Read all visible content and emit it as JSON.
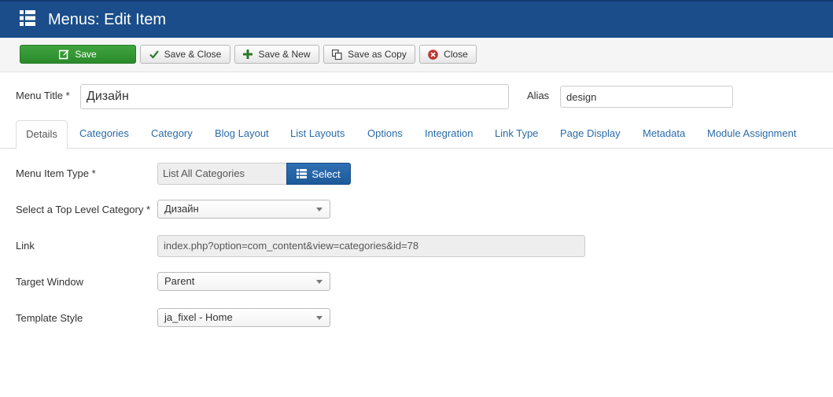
{
  "header": {
    "title": "Menus: Edit Item"
  },
  "toolbar": {
    "save": "Save",
    "save_close": "Save & Close",
    "save_new": "Save & New",
    "save_copy": "Save as Copy",
    "close": "Close"
  },
  "form": {
    "menu_title_label": "Menu Title *",
    "menu_title_value": "Дизайн",
    "alias_label": "Alias",
    "alias_value": "design"
  },
  "tabs": [
    {
      "label": "Details"
    },
    {
      "label": "Categories"
    },
    {
      "label": "Category"
    },
    {
      "label": "Blog Layout"
    },
    {
      "label": "List Layouts"
    },
    {
      "label": "Options"
    },
    {
      "label": "Integration"
    },
    {
      "label": "Link Type"
    },
    {
      "label": "Page Display"
    },
    {
      "label": "Metadata"
    },
    {
      "label": "Module Assignment"
    }
  ],
  "details": {
    "menu_item_type_label": "Menu Item Type *",
    "menu_item_type_value": "List All Categories",
    "select_button": "Select",
    "top_category_label": "Select a Top Level Category *",
    "top_category_value": "Дизайн",
    "link_label": "Link",
    "link_value": "index.php?option=com_content&view=categories&id=78",
    "target_window_label": "Target Window",
    "target_window_value": "Parent",
    "template_style_label": "Template Style",
    "template_style_value": "ja_fixel - Home"
  },
  "colors": {
    "header_bg": "#1a4d8a",
    "save_green": "#2f922f",
    "select_blue": "#2464a8",
    "tab_link": "#2a6ba8"
  }
}
